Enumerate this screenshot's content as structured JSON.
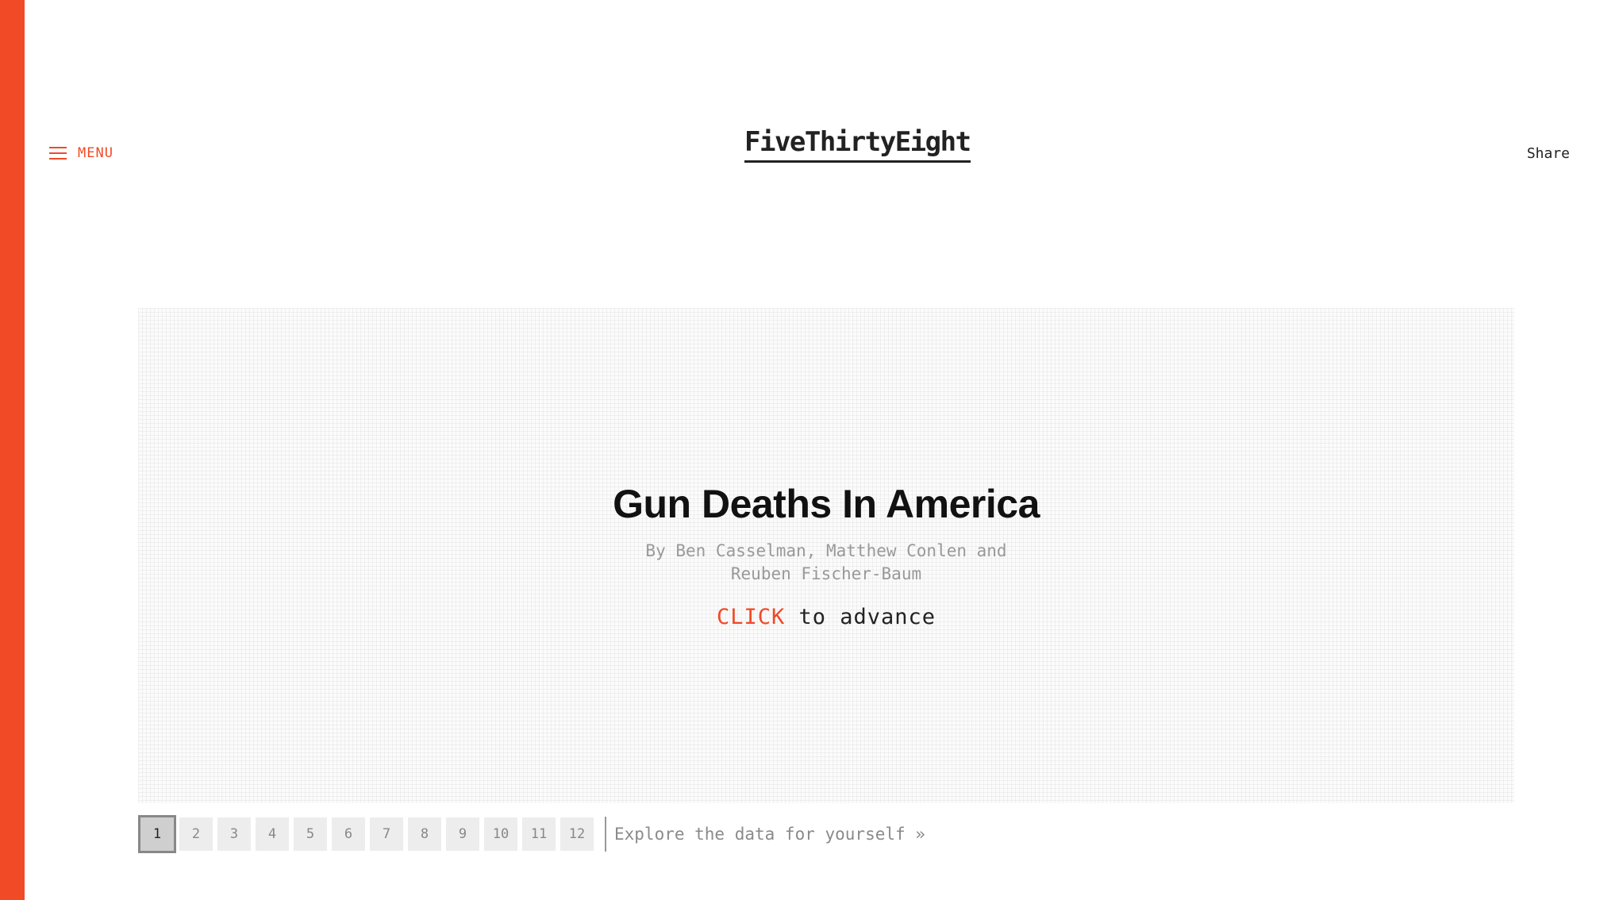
{
  "colors": {
    "accent": "#f14a26",
    "text": "#111111",
    "muted": "#999999",
    "page_button_bg": "#ededed",
    "page_button_active_bg": "#cfcfcf"
  },
  "header": {
    "menu_label": "MENU",
    "menu_icon": "hamburger-icon",
    "logo": "FiveThirtyEight",
    "share_label": "Share"
  },
  "hero": {
    "title": "Gun Deaths In America",
    "byline": "By Ben Casselman, Matthew Conlen and Reuben Fischer-Baum",
    "advance_action": "CLICK",
    "advance_text": " to advance"
  },
  "pager": {
    "pages": [
      "1",
      "2",
      "3",
      "4",
      "5",
      "6",
      "7",
      "8",
      "9",
      "10",
      "11",
      "12"
    ],
    "active_page": "1",
    "explore_label": "Explore the data for yourself »"
  }
}
